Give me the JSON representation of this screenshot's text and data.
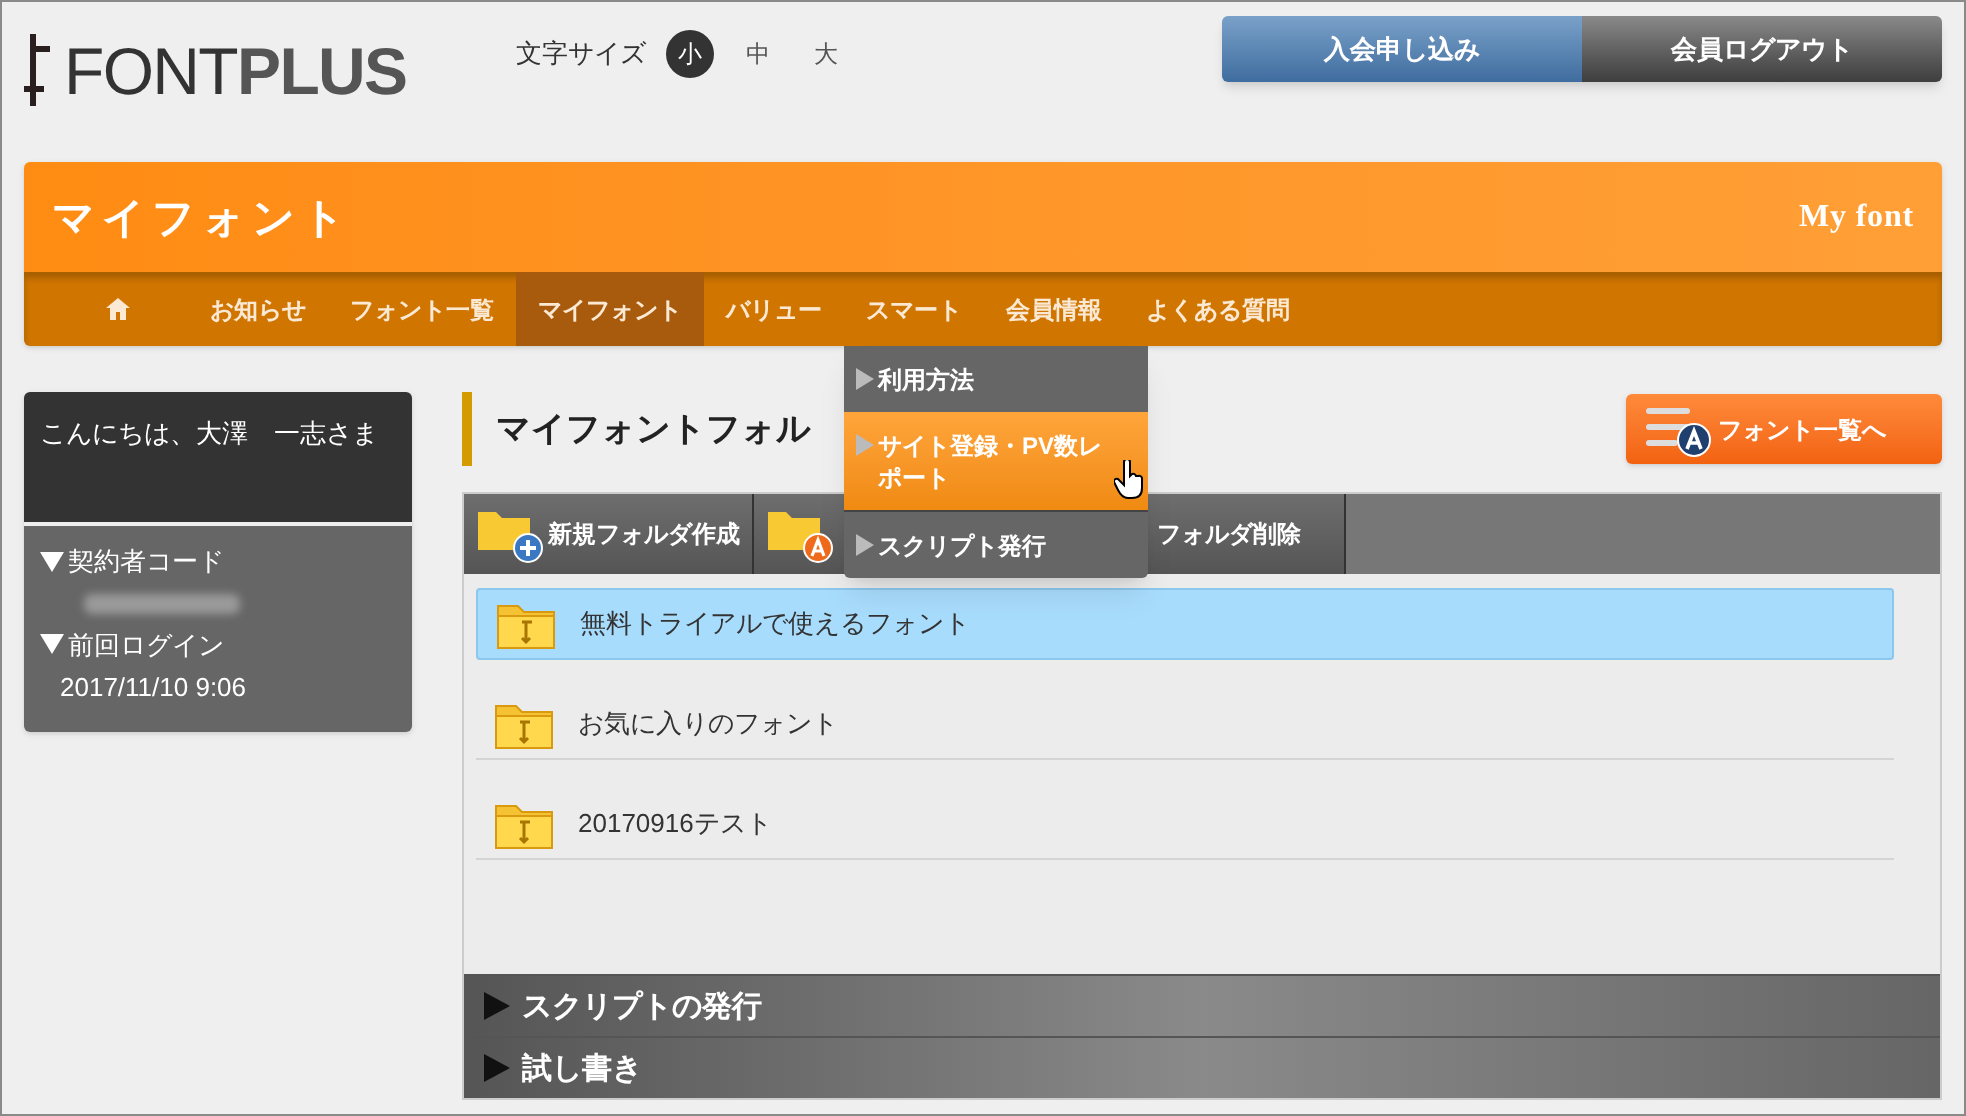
{
  "logo": {
    "light": "FONT",
    "bold": "PLUS"
  },
  "font_size": {
    "label": "文字サイズ",
    "options": [
      {
        "label": "小",
        "selected": true
      },
      {
        "label": "中",
        "selected": false
      },
      {
        "label": "大",
        "selected": false
      }
    ]
  },
  "header_buttons": [
    {
      "label": "入会申し込み",
      "kind": "primary"
    },
    {
      "label": "会員ログアウト",
      "kind": "dark"
    }
  ],
  "page_title": "マイフォント",
  "page_title_en": "My font",
  "nav": [
    {
      "kind": "home",
      "selected": false
    },
    {
      "kind": "text",
      "label": "お知らせ",
      "selected": false
    },
    {
      "kind": "text",
      "label": "フォント一覧",
      "selected": false
    },
    {
      "kind": "text",
      "label": "マイフォント",
      "selected": true
    },
    {
      "kind": "text",
      "label": "バリュー",
      "selected": false
    },
    {
      "kind": "text",
      "label": "スマート",
      "selected": false
    },
    {
      "kind": "text",
      "label": "会員情報",
      "selected": false
    },
    {
      "kind": "text",
      "label": "よくある質問",
      "selected": false
    }
  ],
  "nav_dropdown": {
    "items": [
      {
        "label": "利用方法",
        "selected": false
      },
      {
        "label": "サイト登録・PV数レポート",
        "selected": true
      },
      {
        "label": "スクリプト発行",
        "selected": false
      }
    ]
  },
  "sidebar": {
    "greeting": "こんにちは、大澤　一志さま",
    "sections": [
      {
        "label": "契約者コード",
        "kind": "redacted"
      },
      {
        "label": "前回ログイン",
        "kind": "value",
        "value": "2017/11/10 9:06"
      }
    ]
  },
  "main": {
    "heading": "マイフォントフォル",
    "font_list_button": "フォント一覧へ",
    "toolbar": [
      {
        "kind": "new-folder",
        "label": "新規フォルダ作成"
      },
      {
        "kind": "badge-folder"
      },
      {
        "kind": "plain",
        "label": "フォルダ削除"
      }
    ],
    "folders": [
      {
        "label": "無料トライアルで使えるフォント",
        "selected": true
      },
      {
        "label": "お気に入りのフォント",
        "selected": false
      },
      {
        "label": "20170916テスト",
        "selected": false
      }
    ],
    "accordions": [
      "スクリプトの発行",
      "試し書き"
    ]
  }
}
